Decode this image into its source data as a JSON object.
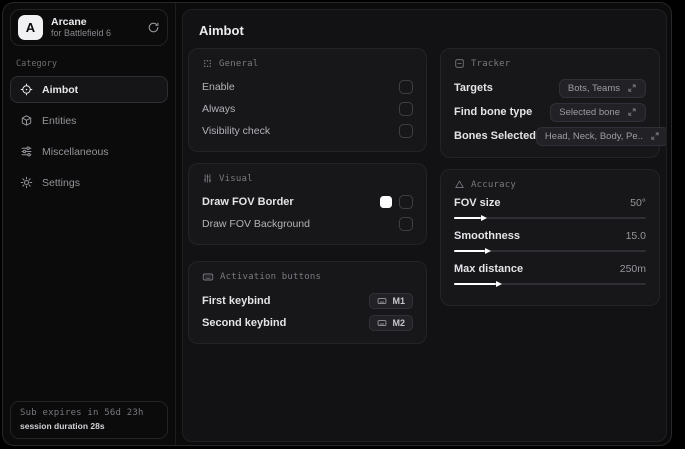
{
  "colors": {
    "fov_border_swatch": "#ffffff",
    "slider_fill": "#ffffff"
  },
  "sidebar": {
    "brand": {
      "initial": "A",
      "title": "Arcane",
      "subtitle": "for Battlefield 6"
    },
    "category_label": "Category",
    "items": [
      {
        "label": "Aimbot",
        "icon": "crosshair-icon",
        "selected": true
      },
      {
        "label": "Entities",
        "icon": "cube-icon",
        "selected": false
      },
      {
        "label": "Miscellaneous",
        "icon": "sliders-icon",
        "selected": false
      },
      {
        "label": "Settings",
        "icon": "gear-icon",
        "selected": false
      }
    ],
    "footer": {
      "line1": "Sub expires in 56d 23h",
      "line2": "session duration 28s"
    }
  },
  "main": {
    "title": "Aimbot",
    "general": {
      "title": "General",
      "rows": [
        {
          "label": "Enable",
          "checked": false
        },
        {
          "label": "Always",
          "checked": false
        },
        {
          "label": "Visibility check",
          "checked": false
        }
      ]
    },
    "visual": {
      "title": "Visual",
      "rows": [
        {
          "label": "Draw FOV Border",
          "swatch": "#ffffff",
          "checked": false
        },
        {
          "label": "Draw FOV Background",
          "checked": false
        }
      ]
    },
    "activation": {
      "title": "Activation buttons",
      "rows": [
        {
          "label": "First keybind",
          "key": "M1"
        },
        {
          "label": "Second keybind",
          "key": "M2"
        }
      ]
    },
    "tracker": {
      "title": "Tracker",
      "rows": [
        {
          "label": "Targets",
          "value": "Bots, Teams"
        },
        {
          "label": "Find bone type",
          "value": "Selected bone"
        },
        {
          "label": "Bones Selected",
          "value": "Head, Neck, Body, Pe.."
        }
      ]
    },
    "accuracy": {
      "title": "Accuracy",
      "sliders": [
        {
          "label": "FOV size",
          "value": "50°",
          "percent": 14
        },
        {
          "label": "Smoothness",
          "value": "15.0",
          "percent": 16
        },
        {
          "label": "Max distance",
          "value": "250m",
          "percent": 22
        }
      ]
    }
  }
}
